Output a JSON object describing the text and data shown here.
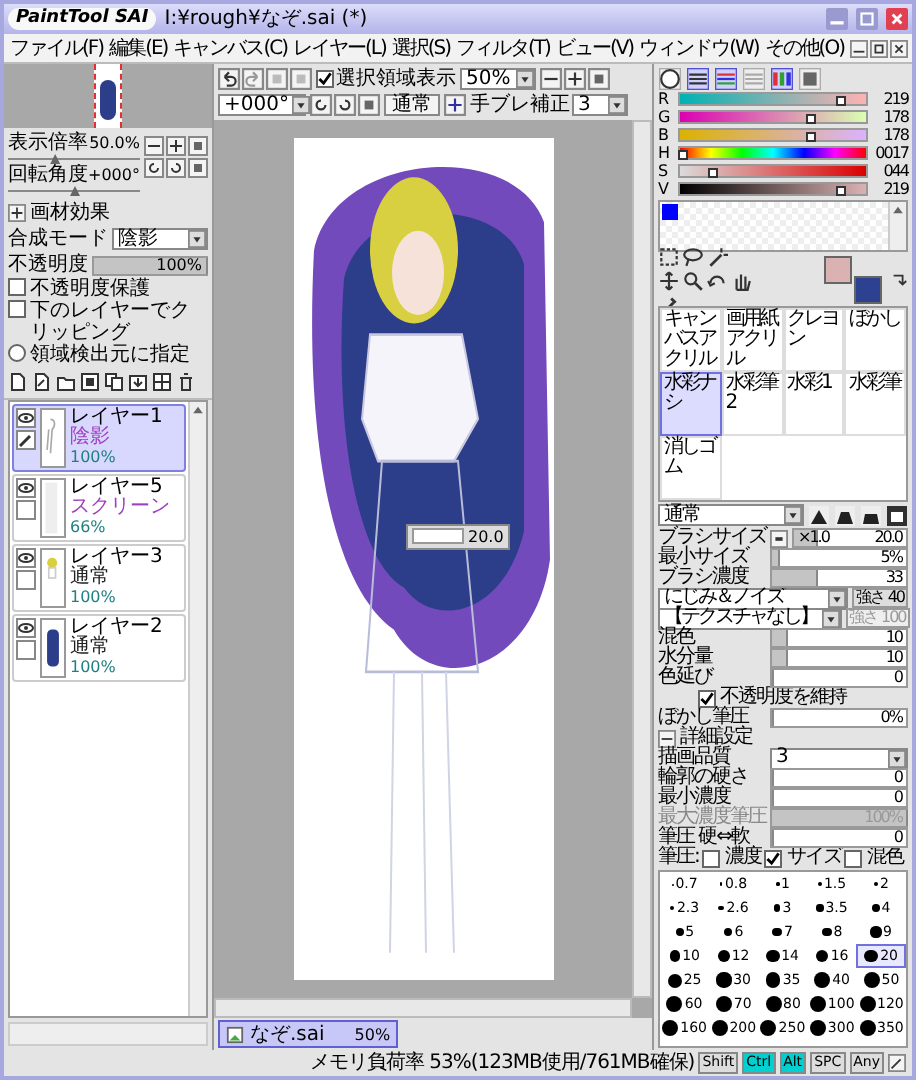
{
  "window": {
    "logo": "PaintTool SAI",
    "title": "I:¥rough¥なぞ.sai (*)"
  },
  "menu": [
    "ファイル(F)",
    "編集(E)",
    "キャンバス(C)",
    "レイヤー(L)",
    "選択(S)",
    "フィルタ(T)",
    "ビュー(V)",
    "ウィンドウ(W)",
    "その他(O)"
  ],
  "navigator": {
    "view_sliders": [
      {
        "label": "表示倍率",
        "value": "50.0%",
        "level": 0.35
      },
      {
        "label": "回転角度",
        "value": "+000°",
        "level": 0.5
      }
    ]
  },
  "layer_panel": {
    "effects": {
      "label": "画材効果",
      "expanded": false
    },
    "blend": {
      "label": "合成モード",
      "value": "陰影"
    },
    "opacity": {
      "label": "不透明度",
      "value": "100%",
      "level": 1
    },
    "options": [
      {
        "kind": "checkbox",
        "label": "不透明度保護",
        "checked": false
      },
      {
        "kind": "checkbox",
        "label": "下のレイヤーでクリッピング",
        "checked": false
      },
      {
        "kind": "radio",
        "label": "領域検出元に指定",
        "checked": false
      }
    ]
  },
  "layers": [
    {
      "name": "レイヤー1",
      "mode": "陰影",
      "opacity": "100%",
      "color": "#a040c0",
      "selected": true,
      "kind": "sketch"
    },
    {
      "name": "レイヤー5",
      "mode": "スクリーン",
      "opacity": "66%",
      "color": "#a040c0",
      "selected": false,
      "kind": "plain"
    },
    {
      "name": "レイヤー3",
      "mode": "通常",
      "opacity": "100%",
      "color": "#202020",
      "selected": false,
      "kind": "figure"
    },
    {
      "name": "レイヤー2",
      "mode": "通常",
      "opacity": "100%",
      "color": "#202020",
      "selected": false,
      "kind": "blue"
    }
  ],
  "canvas_toolbar": {
    "selection_display": {
      "label": "選択領域表示",
      "checked": true
    },
    "zoom": "50%",
    "rotation": "+000°",
    "mode": "通常",
    "stabilizer_label": "手ブレ補正",
    "stabilizer": "3"
  },
  "brush_popup": {
    "value": "20.0"
  },
  "file_tabs": [
    {
      "name": "なぞ.sai",
      "zoom": "50%",
      "selected": true
    }
  ],
  "color_modes": [
    {
      "kind": "wheel",
      "selected": false
    },
    {
      "kind": "rgb",
      "selected": true
    },
    {
      "kind": "hsv",
      "selected": true
    },
    {
      "kind": "gray",
      "selected": false
    },
    {
      "kind": "palette",
      "selected": true
    },
    {
      "kind": "swatch",
      "selected": false
    }
  ],
  "color_sliders": [
    {
      "kind": "r",
      "label": "R",
      "value": "219",
      "level": 0.86
    },
    {
      "kind": "g",
      "label": "G",
      "value": "178",
      "level": 0.7
    },
    {
      "kind": "b",
      "label": "B",
      "value": "178",
      "level": 0.7
    },
    {
      "kind": "h",
      "label": "H",
      "value": "0017",
      "level": 0.01
    },
    {
      "kind": "s",
      "label": "S",
      "value": "044",
      "level": 0.17
    },
    {
      "kind": "v",
      "label": "V",
      "value": "219",
      "level": 0.86
    }
  ],
  "swatches": [
    {
      "color": "#0000ff"
    }
  ],
  "current_colors": [
    {
      "kind": "main",
      "color": "#dbb2b2"
    },
    {
      "kind": "sub",
      "color": "#2c4190"
    }
  ],
  "brushes": [
    {
      "label": "キャンバスアクリル",
      "selected": false
    },
    {
      "label": "画用紙アクリル",
      "selected": false
    },
    {
      "label": "クレヨン",
      "selected": false
    },
    {
      "label": "ぼかし",
      "selected": false
    },
    {
      "label": "水彩ナシ",
      "selected": true
    },
    {
      "label": "水彩筆2",
      "selected": false
    },
    {
      "label": "水彩1",
      "selected": false
    },
    {
      "label": "水彩筆",
      "selected": false
    },
    {
      "label": "消しゴム",
      "selected": false
    }
  ],
  "brush_blend": "通常",
  "brush_shapes": [
    {
      "selected": false
    },
    {
      "selected": false
    },
    {
      "selected": false
    },
    {
      "selected": true
    }
  ],
  "brush_settings": [
    {
      "kind": "size",
      "label": "ブラシサイズ",
      "multiplier": "×1.0",
      "value": "20.0",
      "level": 0.2
    },
    {
      "kind": "slider",
      "label": "最小サイズ",
      "value": "5%",
      "level": 0.05,
      "disabled": false
    },
    {
      "kind": "slider",
      "label": "ブラシ濃度",
      "value": "33",
      "level": 0.33,
      "disabled": false
    },
    {
      "kind": "texture",
      "value": "にじみ＆ノイズ",
      "strength_label": "強さ",
      "strength": "40",
      "disabled": false
    },
    {
      "kind": "texture",
      "value": "【テクスチャなし】",
      "strength_label": "強さ",
      "strength": "100",
      "disabled": true
    },
    {
      "kind": "slider",
      "label": "混色",
      "value": "10",
      "level": 0.1,
      "disabled": false
    },
    {
      "kind": "slider",
      "label": "水分量",
      "value": "10",
      "level": 0.1,
      "disabled": false
    },
    {
      "kind": "slider",
      "label": "色延び",
      "value": "0",
      "level": 0,
      "disabled": false
    },
    {
      "kind": "check",
      "label": "不透明度を維持",
      "checked": true
    },
    {
      "kind": "slider",
      "label": "ぼかし筆圧",
      "value": "0%",
      "level": 0,
      "disabled": false
    },
    {
      "kind": "header",
      "label": "詳細設定",
      "expanded": true
    },
    {
      "kind": "dropdown",
      "label": "描画品質",
      "value": "3"
    },
    {
      "kind": "slider",
      "label": "輪郭の硬さ",
      "value": "0",
      "level": 0,
      "disabled": false
    },
    {
      "kind": "slider",
      "label": "最小濃度",
      "value": "0",
      "level": 0,
      "disabled": false
    },
    {
      "kind": "slider",
      "label": "最大濃度筆圧",
      "value": "100%",
      "level": 1,
      "disabled": true
    },
    {
      "kind": "slider",
      "label": "筆圧 硬⇔軟",
      "value": "0",
      "level": 0,
      "disabled": false
    },
    {
      "kind": "pressure",
      "label": "筆圧:",
      "checks": [
        {
          "label": "濃度",
          "checked": false
        },
        {
          "label": "サイズ",
          "checked": true
        },
        {
          "label": "混色",
          "checked": false
        }
      ]
    }
  ],
  "size_presets": [
    {
      "label": "0.7",
      "selected": false
    },
    {
      "label": "0.8",
      "selected": false
    },
    {
      "label": "1",
      "selected": false
    },
    {
      "label": "1.5",
      "selected": false
    },
    {
      "label": "2",
      "selected": false
    },
    {
      "label": "2.3",
      "selected": false
    },
    {
      "label": "2.6",
      "selected": false
    },
    {
      "label": "3",
      "selected": false
    },
    {
      "label": "3.5",
      "selected": false
    },
    {
      "label": "4",
      "selected": false
    },
    {
      "label": "5",
      "selected": false
    },
    {
      "label": "6",
      "selected": false
    },
    {
      "label": "7",
      "selected": false
    },
    {
      "label": "8",
      "selected": false
    },
    {
      "label": "9",
      "selected": false
    },
    {
      "label": "10",
      "selected": false
    },
    {
      "label": "12",
      "selected": false
    },
    {
      "label": "14",
      "selected": false
    },
    {
      "label": "16",
      "selected": false
    },
    {
      "label": "20",
      "selected": true
    },
    {
      "label": "25",
      "selected": false
    },
    {
      "label": "30",
      "selected": false
    },
    {
      "label": "35",
      "selected": false
    },
    {
      "label": "40",
      "selected": false
    },
    {
      "label": "50",
      "selected": false
    },
    {
      "label": "60",
      "selected": false
    },
    {
      "label": "70",
      "selected": false
    },
    {
      "label": "80",
      "selected": false
    },
    {
      "label": "100",
      "selected": false
    },
    {
      "label": "120",
      "selected": false
    },
    {
      "label": "160",
      "selected": false
    },
    {
      "label": "200",
      "selected": false
    },
    {
      "label": "250",
      "selected": false
    },
    {
      "label": "300",
      "selected": false
    },
    {
      "label": "350",
      "selected": false
    }
  ],
  "status": {
    "memory": "メモリ負荷率 53%(123MB使用/761MB確保)",
    "keys": [
      {
        "label": "Shift",
        "on": false
      },
      {
        "label": "Ctrl",
        "on": true
      },
      {
        "label": "Alt",
        "on": true
      },
      {
        "label": "SPC",
        "on": false
      },
      {
        "label": "Any",
        "on": false
      }
    ]
  }
}
